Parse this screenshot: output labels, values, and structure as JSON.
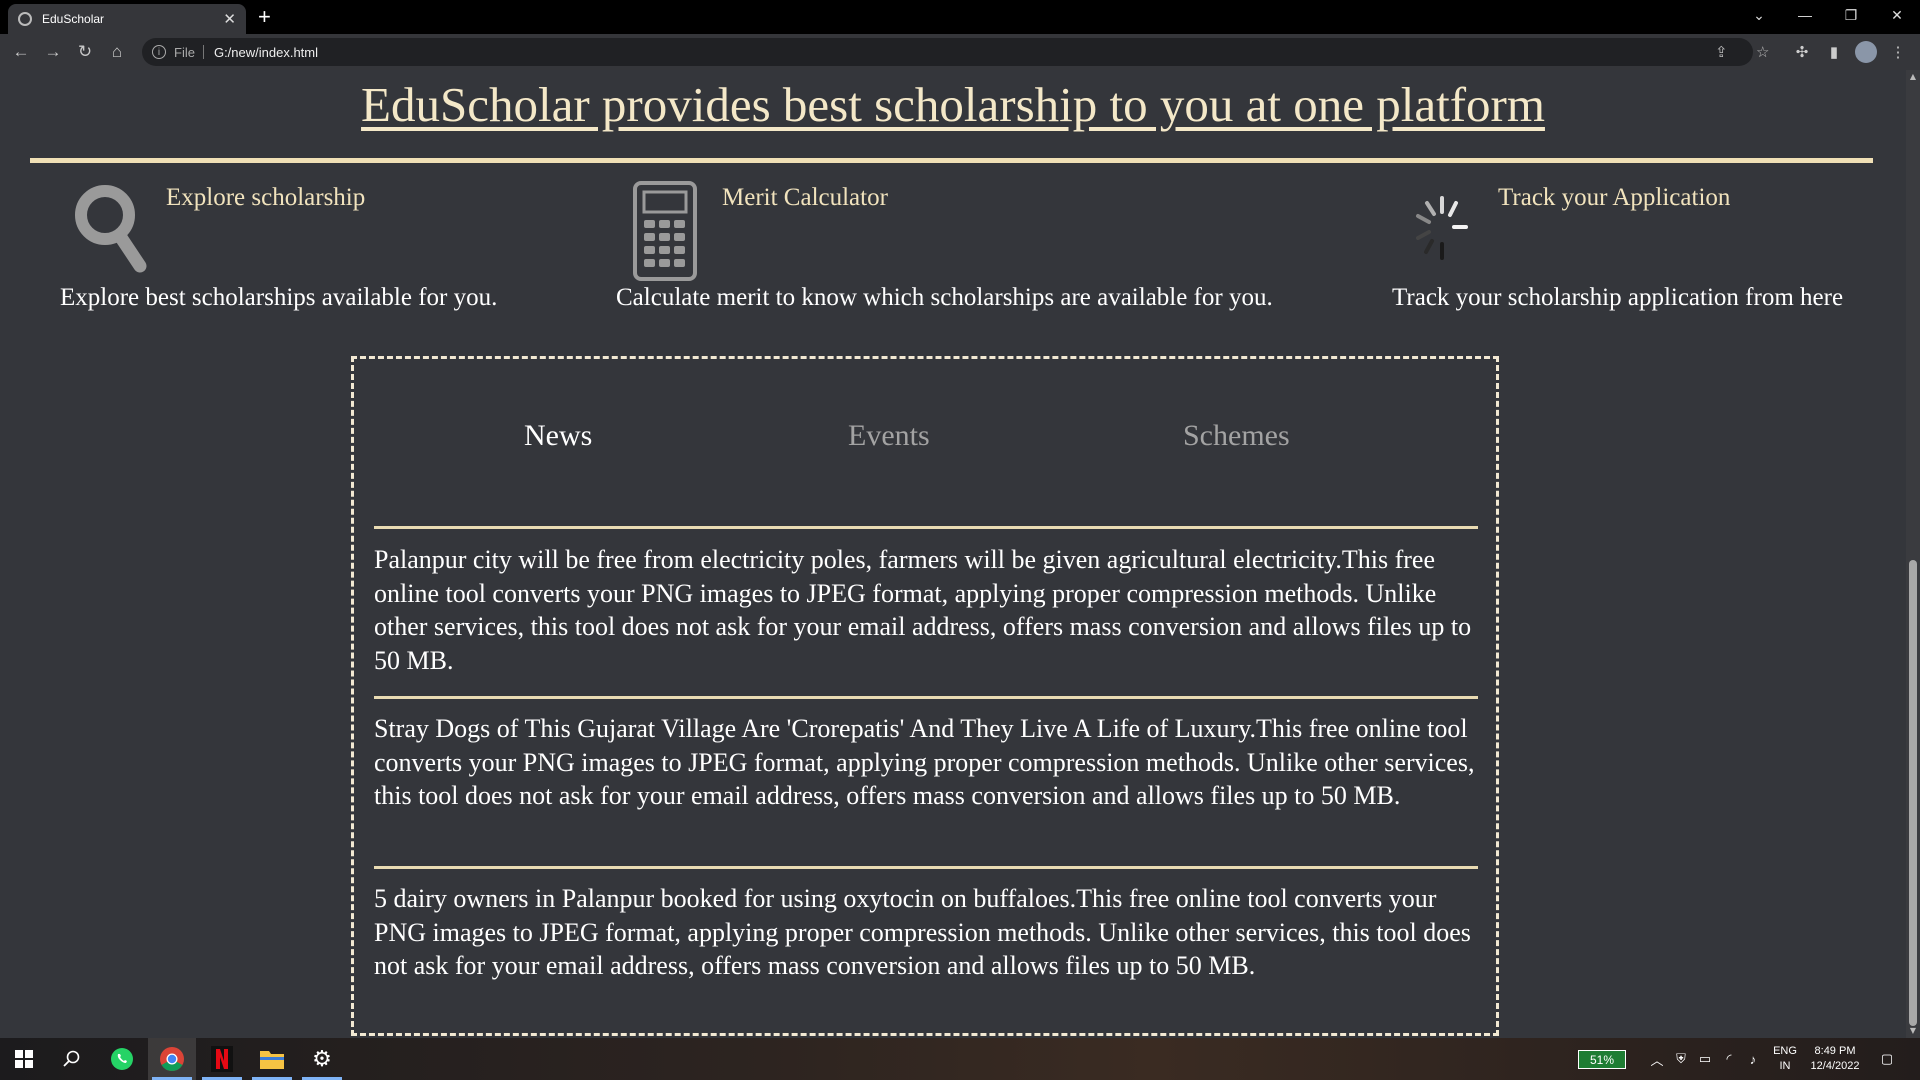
{
  "browser": {
    "tab_title": "EduScholar",
    "scheme": "File",
    "url": "G:/new/index.html"
  },
  "page": {
    "headline": "EduScholar provides best scholarship to you at one platform",
    "features": [
      {
        "title": "Explore scholarship",
        "desc": "Explore best scholarships available for you.",
        "icon": "search-icon"
      },
      {
        "title": "Merit Calculator",
        "desc": "Calculate merit to know which scholarships are available for you.",
        "icon": "calculator-icon"
      },
      {
        "title": "Track your Application",
        "desc": "Track your scholarship application from here",
        "icon": "loading-spinner-icon"
      }
    ],
    "tabs": [
      "News",
      "Events",
      "Schemes"
    ],
    "news": [
      "Palanpur city will be free from electricity poles, farmers will be given agricultural electricity.This free online tool converts your PNG images to JPEG format, applying proper compression methods. Unlike other services, this tool does not ask for your email address, offers mass conversion and allows files up to 50 MB.",
      "Stray Dogs of This Gujarat Village Are 'Crorepatis' And They Live A Life of Luxury.This free online tool converts your PNG images to JPEG format, applying proper compression methods. Unlike other services, this tool does not ask for your email address, offers mass conversion and allows files up to 50 MB.",
      "5 dairy owners in Palanpur booked for using oxytocin on buffaloes.This free online tool converts your PNG images to JPEG format, applying proper compression methods. Unlike other services, this tool does not ask for your email address, offers mass conversion and allows files up to 50 MB."
    ]
  },
  "taskbar": {
    "battery": "51%",
    "lang_top": "ENG",
    "lang_bottom": "IN",
    "time": "8:49 PM",
    "date": "12/4/2022"
  },
  "colors": {
    "page_bg": "#34363b",
    "accent_gold": "#f0e0b6",
    "text": "#ffffff"
  }
}
